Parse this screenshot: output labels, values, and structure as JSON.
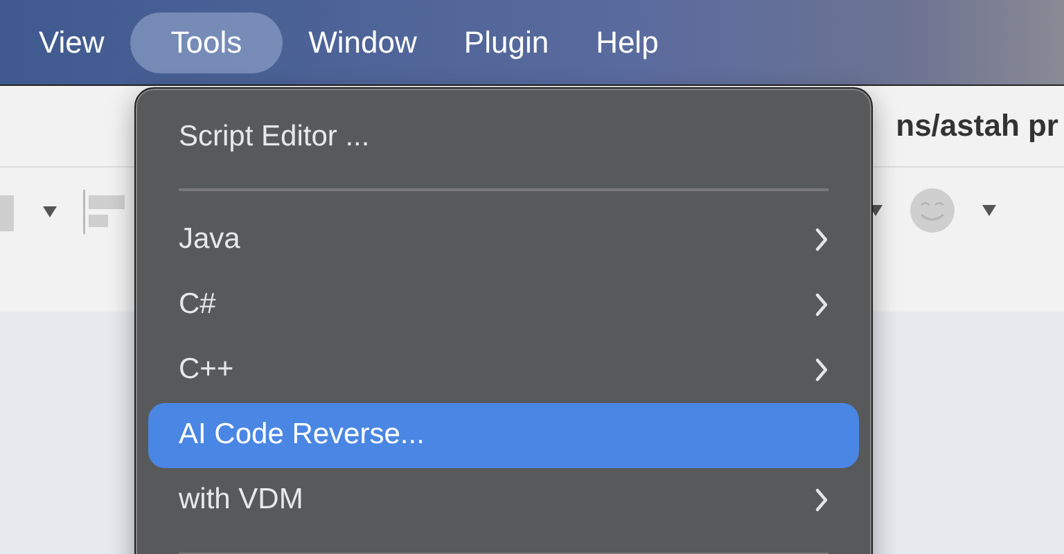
{
  "menu_bar": {
    "items": [
      {
        "label": "View",
        "selected": false
      },
      {
        "label": "Tools",
        "selected": true
      },
      {
        "label": "Window",
        "selected": false
      },
      {
        "label": "Plugin",
        "selected": false
      },
      {
        "label": "Help",
        "selected": false
      }
    ]
  },
  "window": {
    "title": "ns/astah pr"
  },
  "menu": {
    "items": [
      {
        "kind": "item",
        "label": "Script Editor ...",
        "submenu": false,
        "selected": false
      },
      {
        "kind": "separator"
      },
      {
        "kind": "item",
        "label": "Java",
        "submenu": true,
        "selected": false
      },
      {
        "kind": "item",
        "label": "C#",
        "submenu": true,
        "selected": false
      },
      {
        "kind": "item",
        "label": "C++",
        "submenu": true,
        "selected": false
      },
      {
        "kind": "item",
        "label": "AI Code Reverse...",
        "submenu": false,
        "selected": true
      },
      {
        "kind": "item",
        "label": "with VDM",
        "submenu": true,
        "selected": false
      },
      {
        "kind": "separator"
      }
    ]
  }
}
